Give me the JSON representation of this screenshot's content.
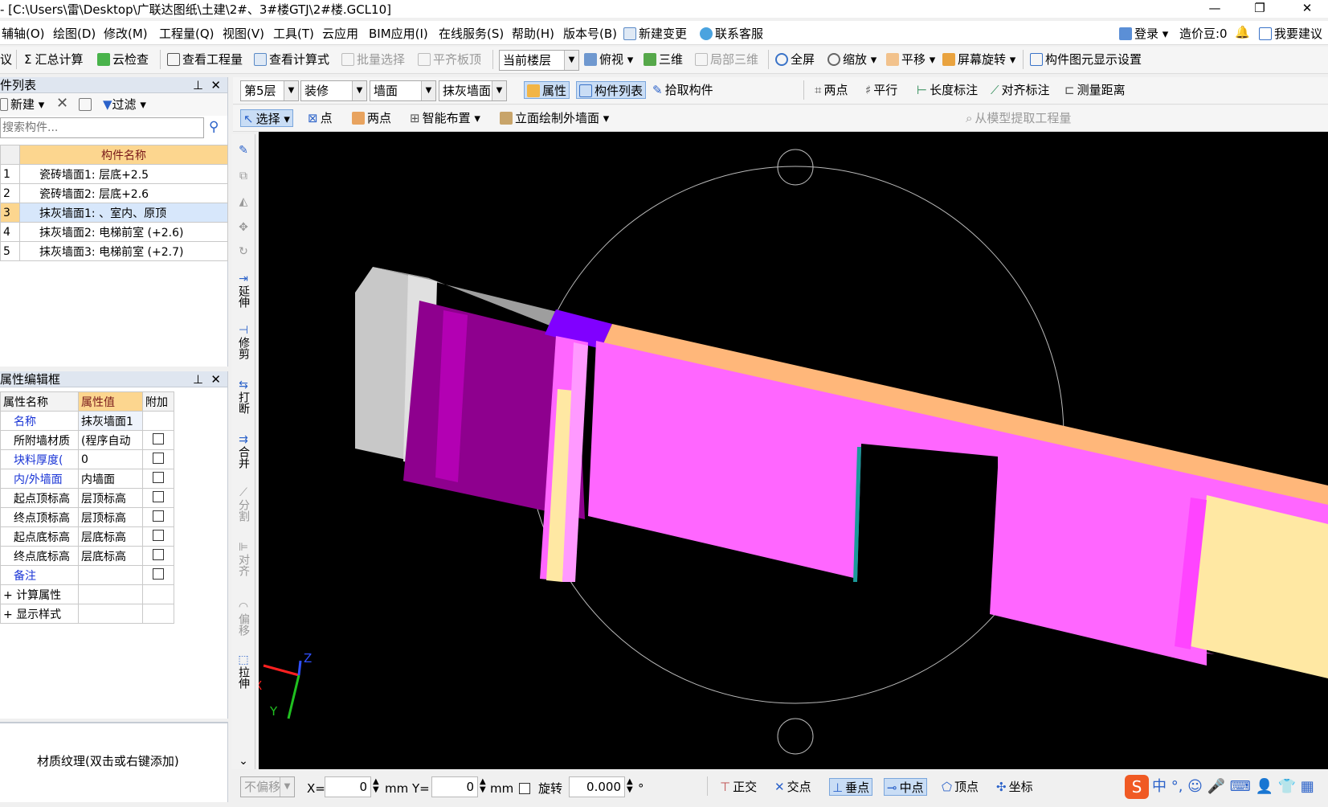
{
  "window": {
    "title": "- [C:\\Users\\雷\\Desktop\\广联达图纸\\土建\\2#、3#楼GTJ\\2#楼.GCL10]",
    "minimize": "—",
    "maximize": "❐",
    "close": "✕"
  },
  "menu": {
    "items": [
      "辅轴(O)",
      "绘图(D)",
      "修改(M)",
      "工程量(Q)",
      "视图(V)",
      "工具(T)",
      "云应用",
      "BIM应用(I)",
      "在线服务(S)",
      "帮助(H)",
      "版本号(B)",
      "新建变更",
      "联系客服"
    ],
    "right": {
      "login": "登录",
      "bean": "造价豆:0",
      "suggest": "我要建议"
    }
  },
  "toolbar1": {
    "items": [
      "议",
      "汇总计算",
      "云检查",
      "查看工程量",
      "查看计算式",
      "批量选择",
      "平齐板顶"
    ],
    "floor_combo": "当前楼层",
    "view_items": [
      "俯视",
      "三维",
      "局部三维",
      "全屏",
      "缩放",
      "平移",
      "屏幕旋转",
      "构件图元显示设置"
    ]
  },
  "toolbar2": {
    "floor": "第5层",
    "category": "装修",
    "type": "墙面",
    "component": "抹灰墙面",
    "props_btn": "属性",
    "list_btn": "构件列表",
    "pick_btn": "拾取构件",
    "measure": [
      "两点",
      "平行",
      "长度标注",
      "对齐标注",
      "测量距离"
    ]
  },
  "toolbar3": {
    "select": "选择",
    "point": "点",
    "two_points": "两点",
    "smart": "智能布置",
    "elevation": "立面绘制外墙面",
    "extract": "从模型提取工程量"
  },
  "component_list": {
    "header": "件列表",
    "new_btn": "新建",
    "filter_btn": "过滤",
    "search_placeholder": "搜索构件...",
    "col_header": "构件名称",
    "rows": [
      {
        "no": "1",
        "name": "瓷砖墙面1: 层底+2.5"
      },
      {
        "no": "2",
        "name": "瓷砖墙面2: 层底+2.6"
      },
      {
        "no": "3",
        "name": "抹灰墙面1: 、室内、原顶"
      },
      {
        "no": "4",
        "name": "抹灰墙面2: 电梯前室 (+2.6)"
      },
      {
        "no": "5",
        "name": "抹灰墙面3: 电梯前室 (+2.7)"
      }
    ]
  },
  "property_panel": {
    "header": "属性编辑框",
    "cols": [
      "属性名称",
      "属性值",
      "附加"
    ],
    "rows": [
      {
        "name": "名称",
        "value": "抹灰墙面1"
      },
      {
        "name": "所附墙材质",
        "value": "(程序自动"
      },
      {
        "name": "块料厚度(",
        "value": "0"
      },
      {
        "name": "内/外墙面",
        "value": "内墙面"
      },
      {
        "name": "起点顶标高",
        "value": "层顶标高"
      },
      {
        "name": "终点顶标高",
        "value": "层顶标高"
      },
      {
        "name": "起点底标高",
        "value": "层底标高"
      },
      {
        "name": "终点底标高",
        "value": "层底标高"
      },
      {
        "name": "备注",
        "value": ""
      },
      {
        "name": "计算属性",
        "value": ""
      },
      {
        "name": "显示样式",
        "value": ""
      }
    ],
    "texture_hint": "材质纹理(双击或右键添加)"
  },
  "vertical_tools": [
    "延伸",
    "修剪",
    "打断",
    "合并",
    "分割",
    "对齐",
    "偏移",
    "拉伸"
  ],
  "axes": {
    "x": "X",
    "y": "Y",
    "z": "Z"
  },
  "status": {
    "offset": "不偏移",
    "x_label": "X=",
    "x_val": "0",
    "y_label": "mm Y=",
    "y_val": "0",
    "mm": "mm",
    "rotate": "旋转",
    "rotate_val": "0.000",
    "deg": "°",
    "snaps": [
      "正交",
      "交点",
      "垂点",
      "中点",
      "顶点",
      "坐标"
    ]
  },
  "colors": {
    "magenta": "#ff66ff",
    "purple": "#990099",
    "peach": "#ffb77a",
    "cream": "#ffe8a3",
    "grey": "#bfbfbf",
    "violet": "#8000ff"
  }
}
